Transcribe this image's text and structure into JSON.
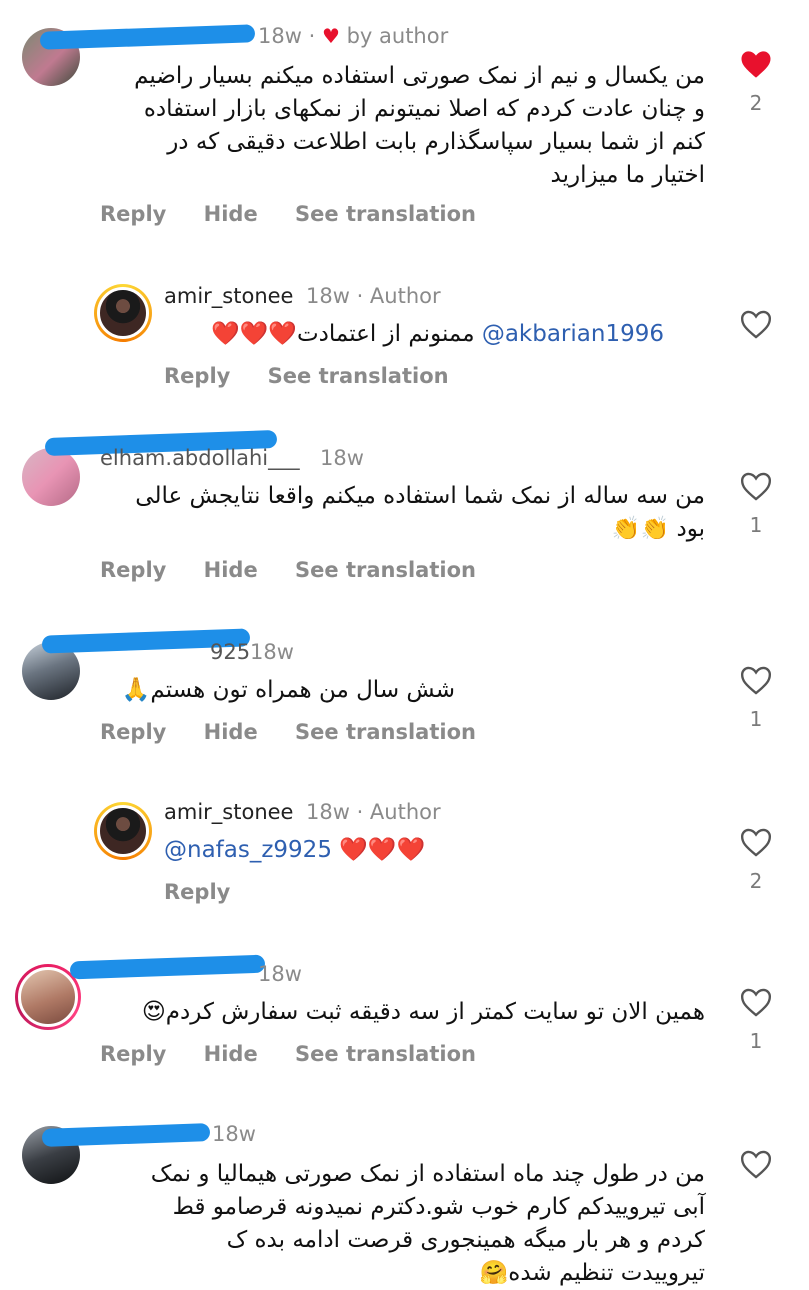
{
  "comments": [
    {
      "meta": "18w",
      "liked_by_author": "by author",
      "text": "من یکسال و نیم از نمک صورتی استفاده میکنم بسیار راضیم\nو چنان عادت کردم که اصلا نمیتونم از نمکهای بازار استفاده\nکنم از شما بسیار سپاسگذارم بابت اطلاعت دقیقی که در\nاختیار ما میزارید",
      "like_count": "2",
      "actions": {
        "reply": "Reply",
        "hide": "Hide",
        "translate": "See translation"
      }
    },
    {
      "username": "amir_stonee",
      "meta": "18w · Author",
      "mention": "@akbarian1996",
      "text": "ممنونم از اعتمادت❤️❤️❤️",
      "actions": {
        "reply": "Reply",
        "translate": "See translation"
      }
    },
    {
      "username_partial": "elham.abdollahi___",
      "meta": "18w",
      "text": "من سه ساله از نمک شما استفاده میکنم واقعا نتایجش عالی\nبود 👏👏",
      "like_count": "1",
      "actions": {
        "reply": "Reply",
        "hide": "Hide",
        "translate": "See translation"
      }
    },
    {
      "username_partial": "925",
      "meta": "18w",
      "text": "شش سال من همراه تون هستم🙏",
      "like_count": "1",
      "actions": {
        "reply": "Reply",
        "hide": "Hide",
        "translate": "See translation"
      }
    },
    {
      "username": "amir_stonee",
      "meta": "18w · Author",
      "mention": "@nafas_z9925",
      "text": "❤️❤️❤️",
      "like_count": "2",
      "actions": {
        "reply": "Reply"
      }
    },
    {
      "meta": "18w",
      "text": "همین الان تو سایت کمتر از سه دقیقه ثبت سفارش کردم😍",
      "like_count": "1",
      "actions": {
        "reply": "Reply",
        "hide": "Hide",
        "translate": "See translation"
      }
    },
    {
      "meta": "18w",
      "text": "من در طول چند ماه استفاده از نمک صورتی هیمالیا و نمک\nآبی تیروییدکم کارم خوب شو.دکترم نمیدونه قرصامو قط\nکردم و هر بار میگه همینجوری قرصت ادامه بده ک\nتیروییدت تنظیم شده🤗"
    }
  ],
  "colors": {
    "heart_red": "#e8112d",
    "mention_blue": "#2e5fb0",
    "redaction_blue": "#1e8fe8"
  },
  "icons": {
    "like_filled": "heart-filled-icon",
    "like_outline": "heart-outline-icon"
  }
}
